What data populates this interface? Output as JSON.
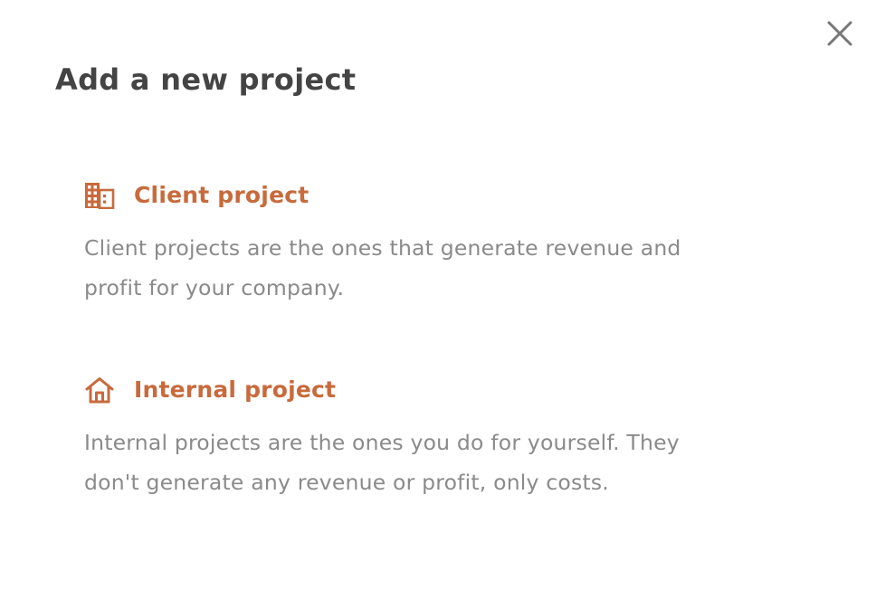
{
  "dialog": {
    "title": "Add a new project",
    "close_icon": "close-icon"
  },
  "options": [
    {
      "icon": "building-icon",
      "title": "Client project",
      "description": "Client projects are the ones that generate revenue and profit for your company."
    },
    {
      "icon": "home-icon",
      "title": "Internal project",
      "description": "Internal projects are the ones you do for yourself. They don't generate any revenue or profit, only costs."
    }
  ],
  "colors": {
    "accent": "#c86a3c",
    "title_text": "#444444",
    "body_text": "#8a8a8a",
    "close_icon": "#777777"
  }
}
